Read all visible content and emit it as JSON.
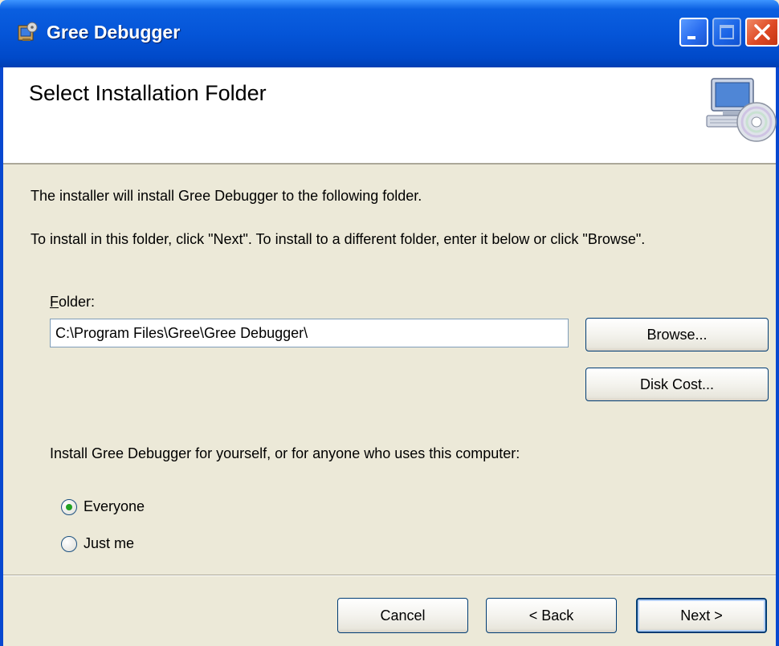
{
  "window": {
    "title": "Gree Debugger",
    "app_icon": "installer-icon",
    "controls": [
      "minimize-icon",
      "maximize-icon",
      "close-icon"
    ]
  },
  "banner": {
    "title": "Select Installation Folder",
    "icon": "computer-cd-icon"
  },
  "body": {
    "line1": "The installer will install Gree Debugger to the following folder.",
    "line2": "To install in this folder, click \"Next\". To install to a different folder, enter it below or click \"Browse\"."
  },
  "folder": {
    "label_access_key": "F",
    "label_rest": "older:",
    "value": "C:\\Program Files\\Gree\\Gree Debugger\\",
    "browse_label": "Browse...",
    "disk_cost_label": "Disk Cost..."
  },
  "install_for": {
    "prompt": "Install Gree Debugger for yourself, or for anyone who uses this computer:",
    "options": [
      {
        "label": "Everyone",
        "selected": true
      },
      {
        "label": "Just me",
        "selected": false
      }
    ]
  },
  "footer": {
    "cancel_label": "Cancel",
    "back_label": "< Back",
    "next_label": "Next >"
  },
  "colors": {
    "titlebar": "#0555d8",
    "dialog_bg": "#ece9d8",
    "close_button": "#de4a25",
    "radio_selected": "#21a121"
  }
}
